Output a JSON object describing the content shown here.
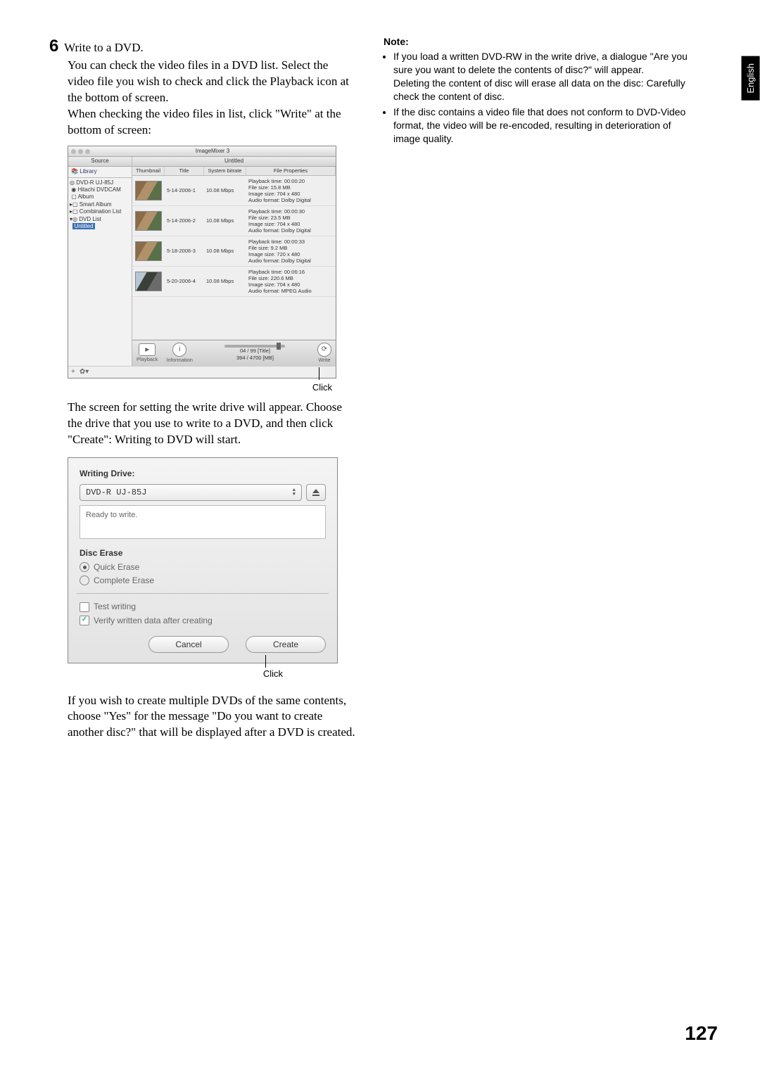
{
  "lang_tab": "English",
  "page_number": "127",
  "left": {
    "step_number": "6",
    "step_title": "Write to a DVD.",
    "para1": "You can check the video files in a DVD list. Select the video file you wish to check and click the Playback icon at the bottom of screen.",
    "para2": "When checking the video files in list, click \"Write\" at the bottom of screen:",
    "click1": "Click",
    "para3": "The screen for setting the write drive will appear. Choose the drive that you use to write to a DVD, and then click \"Create\": Writing to DVD will start.",
    "click2": "Click",
    "para4": "If you wish to create multiple DVDs of the same contents, choose \"Yes\" for the message \"Do you want to create another disc?\" that will be displayed after a DVD is created."
  },
  "scr1": {
    "title": "ImageMixer 3",
    "sidebar_source": "Source",
    "sidebar_library": "Library",
    "tree": {
      "dvd_r": "DVD-R  UJ-85J",
      "hitachi": "Hitachi DVDCAM",
      "album": "Album",
      "smart": "Smart Album",
      "combo": "Combination List",
      "dvdlist": "DVD List",
      "untitled": "Untitled"
    },
    "tab": "Untitled",
    "thead": {
      "thumb": "Thumbnail",
      "title": "Title",
      "bitrate": "System bitrate",
      "props": "File Properties"
    },
    "bitrate_val": "10.08 Mbps",
    "rows": [
      {
        "title": "5-14-2006-1",
        "pb": "Playback time: 00:00:20",
        "fs": "File size: 15.8 MB",
        "im": "Image size: 704 x 480",
        "au": "Audio format: Dolby Digital"
      },
      {
        "title": "5-14-2006-2",
        "pb": "Playback time: 00:00:30",
        "fs": "File size: 23.5 MB",
        "im": "Image size: 704 x 480",
        "au": "Audio format: Dolby Digital"
      },
      {
        "title": "5-18-2006-3",
        "pb": "Playback time: 00:00:33",
        "fs": "File size: 9.2 MB",
        "im": "Image size: 720 x 480",
        "au": "Audio format: Dolby Digital"
      },
      {
        "title": "5-20-2006-4",
        "pb": "Playback time: 00:06:16",
        "fs": "File size: 220.6 MB",
        "im": "Image size: 704 x 480",
        "au": "Audio format: MPEG Audio"
      }
    ],
    "toolbar": {
      "playback": "Playback",
      "information": "Information",
      "count": "04 / 99 [Title]",
      "size": "394 / 4700 [MB]",
      "write": "Write"
    }
  },
  "scr2": {
    "heading": "Writing Drive:",
    "drive": "DVD-R  UJ-85J",
    "status": "Ready to write.",
    "erase_heading": "Disc Erase",
    "quick": "Quick Erase",
    "complete": "Complete Erase",
    "test": "Test writing",
    "verify": "Verify written data after creating",
    "cancel": "Cancel",
    "create": "Create"
  },
  "right": {
    "note_head": "Note:",
    "note1a": "If you load a written DVD-RW in the write drive, a dialogue \"Are you sure you want to delete the contents of disc?\" will appear.",
    "note1b": "Deleting the content of disc will erase all data on the disc: Carefully check the content of disc.",
    "note2": "If the disc contains a video file that does not conform to DVD-Video format, the video will be re-encoded, resulting in deterioration of image quality."
  }
}
